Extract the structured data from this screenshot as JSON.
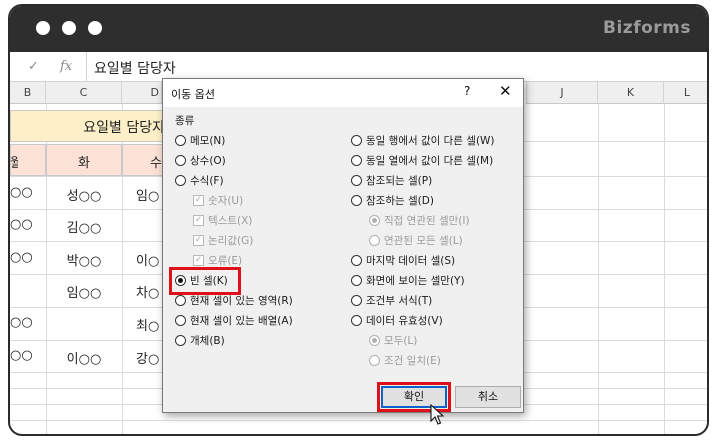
{
  "window": {
    "brand": "Bizforms"
  },
  "formula_bar": {
    "cancel_symbol": "✓",
    "fx_symbol": "fx",
    "value": "요일별 담당자"
  },
  "columns": [
    "B",
    "C",
    "D",
    "J",
    "K",
    "L"
  ],
  "sheet": {
    "title_cell": "요일별 담당자",
    "headers": [
      "월",
      "화",
      "수"
    ],
    "rows": [
      [
        "○○",
        "성○○",
        "임○"
      ],
      [
        "○○",
        "김○○",
        ""
      ],
      [
        "○○",
        "박○○",
        "이○"
      ],
      [
        "",
        "임○○",
        "차○"
      ],
      [
        "○○",
        "",
        "최○"
      ],
      [
        "○○",
        "이○○",
        "강○"
      ]
    ]
  },
  "dialog": {
    "title": "이동 옵션",
    "help": "?",
    "close": "✕",
    "group_label": "종류",
    "left_options": [
      {
        "label": "메모(N)",
        "kind": "radio",
        "selected": false,
        "disabled": false
      },
      {
        "label": "상수(O)",
        "kind": "radio",
        "selected": false,
        "disabled": false
      },
      {
        "label": "수식(F)",
        "kind": "radio",
        "selected": false,
        "disabled": false
      },
      {
        "label": "숫자(U)",
        "kind": "check",
        "selected": true,
        "disabled": true
      },
      {
        "label": "텍스트(X)",
        "kind": "check",
        "selected": true,
        "disabled": true
      },
      {
        "label": "논리값(G)",
        "kind": "check",
        "selected": true,
        "disabled": true
      },
      {
        "label": "오류(E)",
        "kind": "check",
        "selected": true,
        "disabled": true
      },
      {
        "label": "빈 셀(K)",
        "kind": "radio",
        "selected": true,
        "disabled": false
      },
      {
        "label": "현재 셀이 있는 영역(R)",
        "kind": "radio",
        "selected": false,
        "disabled": false
      },
      {
        "label": "현재 셀이 있는 배열(A)",
        "kind": "radio",
        "selected": false,
        "disabled": false
      },
      {
        "label": "개체(B)",
        "kind": "radio",
        "selected": false,
        "disabled": false
      }
    ],
    "right_options": [
      {
        "label": "동일 행에서 값이 다른 셀(W)",
        "kind": "radio",
        "selected": false,
        "disabled": false
      },
      {
        "label": "동일 열에서 값이 다른 셀(M)",
        "kind": "radio",
        "selected": false,
        "disabled": false
      },
      {
        "label": "참조되는 셀(P)",
        "kind": "radio",
        "selected": false,
        "disabled": false
      },
      {
        "label": "참조하는 셀(D)",
        "kind": "radio",
        "selected": false,
        "disabled": false
      },
      {
        "label": "직접 연관된 셀만(I)",
        "kind": "radio",
        "selected": true,
        "disabled": true
      },
      {
        "label": "연관된 모든 셀(L)",
        "kind": "radio",
        "selected": false,
        "disabled": true
      },
      {
        "label": "마지막 데이터 셀(S)",
        "kind": "radio",
        "selected": false,
        "disabled": false
      },
      {
        "label": "화면에 보이는 셀만(Y)",
        "kind": "radio",
        "selected": false,
        "disabled": false
      },
      {
        "label": "조건부 서식(T)",
        "kind": "radio",
        "selected": false,
        "disabled": false
      },
      {
        "label": "데이터 유효성(V)",
        "kind": "radio",
        "selected": false,
        "disabled": false
      },
      {
        "label": "모두(L)",
        "kind": "radio",
        "selected": true,
        "disabled": true
      },
      {
        "label": "조건 일치(E)",
        "kind": "radio",
        "selected": false,
        "disabled": true
      }
    ],
    "ok_label": "확인",
    "cancel_label": "취소"
  },
  "colors": {
    "highlight": "#e0101a",
    "title_cell_fill": "#fdf0c8",
    "header_fill": "#fbe1d6"
  }
}
